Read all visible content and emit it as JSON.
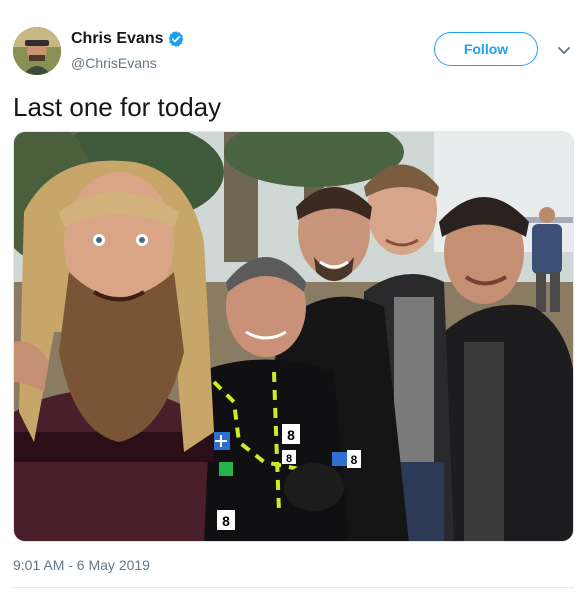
{
  "tweet": {
    "author": {
      "display_name": "Chris Evans",
      "handle": "@ChrisEvans",
      "verified": true,
      "avatar_icon": "avatar-photo"
    },
    "follow_label": "Follow",
    "menu_icon": "chevron-down-icon",
    "text": "Last one for today",
    "media": {
      "type": "photo",
      "mocap_markers": [
        "8",
        "8",
        "8",
        "8"
      ]
    },
    "timestamp": "9:01 AM - 6 May 2019"
  },
  "colors": {
    "accent": "#1da1f2",
    "secondary_text": "#657786",
    "primary_text": "#14171a"
  }
}
